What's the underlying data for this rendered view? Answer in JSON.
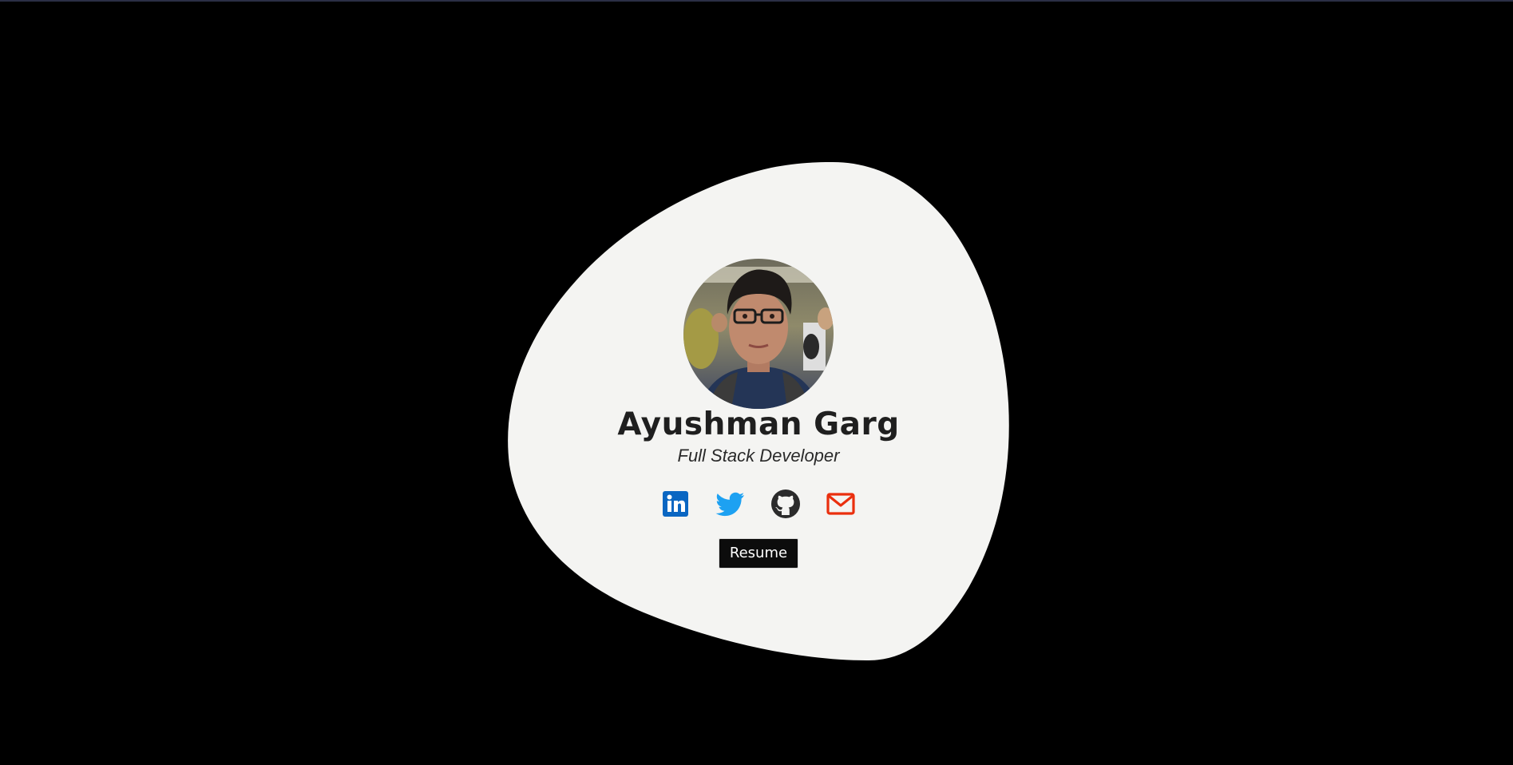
{
  "profile": {
    "name": "Ayushman Garg",
    "title": "Full Stack Developer",
    "photo_alt": "profile photo"
  },
  "socials": [
    {
      "name": "LinkedIn",
      "icon": "linkedin-icon",
      "color": "#0a66c2"
    },
    {
      "name": "Twitter",
      "icon": "twitter-icon",
      "color": "#1da1f2"
    },
    {
      "name": "GitHub",
      "icon": "github-icon",
      "color": "#2b2b2b"
    },
    {
      "name": "Email",
      "icon": "mail-icon",
      "color": "#ea2f0e"
    }
  ],
  "resume_button": {
    "label": "Resume"
  },
  "colors": {
    "background": "#000000",
    "card": "#f4f4f2",
    "text": "#1f1f1f"
  }
}
